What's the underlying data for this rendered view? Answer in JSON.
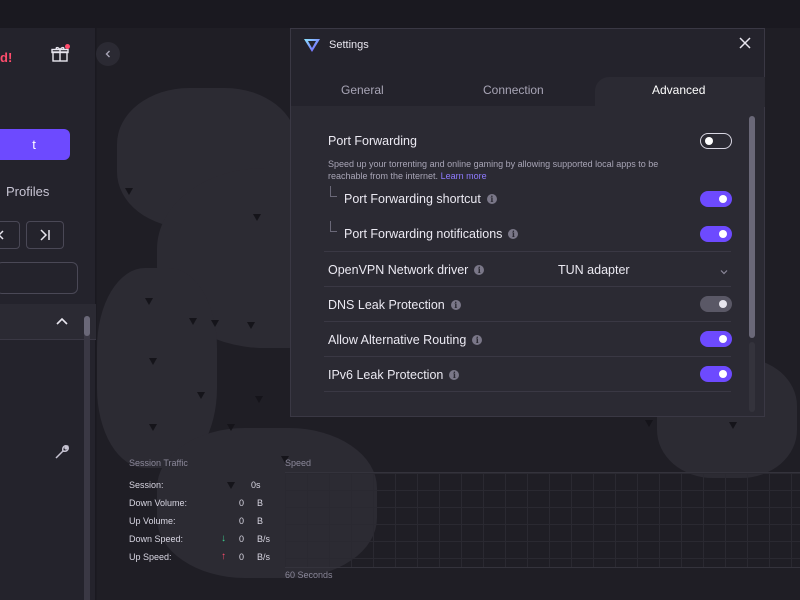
{
  "app": {
    "status_text": "d!",
    "connect_label": "t",
    "profiles_label": "Profiles"
  },
  "stats": {
    "title": "Session Traffic",
    "rows": [
      {
        "label": "Session:",
        "arrow": "",
        "value": "0s",
        "unit": ""
      },
      {
        "label": "Down Volume:",
        "arrow": "",
        "value": "0",
        "unit": "B"
      },
      {
        "label": "Up Volume:",
        "arrow": "",
        "value": "0",
        "unit": "B"
      },
      {
        "label": "Down Speed:",
        "arrow": "↓",
        "value": "0",
        "unit": "B/s"
      },
      {
        "label": "Up Speed:",
        "arrow": "↑",
        "value": "0",
        "unit": "B/s"
      }
    ],
    "speed_title": "Speed",
    "speed_footer": "60 Seconds",
    "down_color": "#3ccf8e",
    "up_color": "#ff4d6d"
  },
  "settings": {
    "title": "Settings",
    "tabs": [
      {
        "label": "General",
        "active": false
      },
      {
        "label": "Connection",
        "active": false
      },
      {
        "label": "Advanced",
        "active": true
      }
    ],
    "port_forwarding": {
      "label": "Port Forwarding",
      "enabled": false,
      "description": "Speed up your torrenting and online gaming by allowing supported local apps to be reachable from the internet.",
      "learn_more": "Learn more"
    },
    "pf_shortcut": {
      "label": "Port Forwarding shortcut",
      "enabled": true
    },
    "pf_notifications": {
      "label": "Port Forwarding notifications",
      "enabled": true
    },
    "openvpn_driver": {
      "label": "OpenVPN Network driver",
      "value": "TUN adapter"
    },
    "dns_leak": {
      "label": "DNS Leak Protection",
      "enabled": true,
      "disabled": true
    },
    "alt_routing": {
      "label": "Allow Alternative Routing",
      "enabled": true
    },
    "ipv6_leak": {
      "label": "IPv6 Leak Protection",
      "enabled": true
    },
    "accent": "#6d4aff"
  }
}
